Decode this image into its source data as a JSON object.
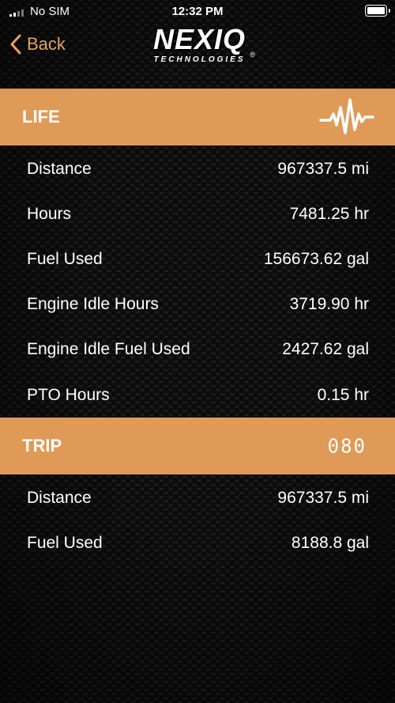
{
  "status_bar": {
    "carrier": "No SIM",
    "time": "12:32 PM"
  },
  "nav": {
    "back_label": "Back",
    "logo_brand": "NEXIQ",
    "logo_sub": "TECHNOLOGIES",
    "logo_reg": "®"
  },
  "life": {
    "title": "LIFE",
    "icon": "waveform-icon",
    "rows": [
      {
        "label": "Distance",
        "value": "967337.5 mi"
      },
      {
        "label": "Hours",
        "value": "7481.25 hr"
      },
      {
        "label": "Fuel Used",
        "value": "156673.62 gal"
      },
      {
        "label": "Engine Idle Hours",
        "value": "3719.90 hr"
      },
      {
        "label": "Engine Idle Fuel Used",
        "value": "2427.62 gal"
      },
      {
        "label": "PTO Hours",
        "value": "0.15 hr"
      }
    ]
  },
  "trip": {
    "title": "TRIP",
    "readout": "080",
    "rows": [
      {
        "label": "Distance",
        "value": "967337.5 mi"
      },
      {
        "label": "Fuel Used",
        "value": "8188.8 gal"
      }
    ]
  },
  "colors": {
    "accent": "#df9a57",
    "back_link": "#e8a15b",
    "text": "#ffffff",
    "background": "#1b1b1b"
  }
}
